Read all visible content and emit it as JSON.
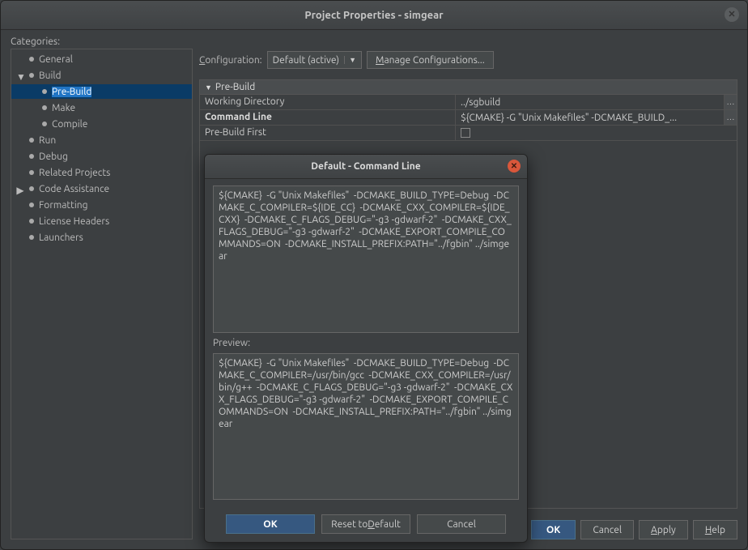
{
  "window": {
    "title": "Project Properties - simgear"
  },
  "categories_label": "Categories:",
  "tree": {
    "general": "General",
    "build": "Build",
    "prebuild": "Pre-Build",
    "make": "Make",
    "compile": "Compile",
    "run": "Run",
    "debug": "Debug",
    "related": "Related Projects",
    "codeassist": "Code Assistance",
    "formatting": "Formatting",
    "license": "License Headers",
    "launchers": "Launchers"
  },
  "config": {
    "label_pre": "C",
    "label_post": "onfiguration:",
    "value": "Default (active)",
    "manage_pre": "M",
    "manage_post": "anage Configurations..."
  },
  "props": {
    "section": "Pre-Build",
    "working_dir_key": "Working Directory",
    "working_dir_val": "../sgbuild",
    "cmdline_key": "Command Line",
    "cmdline_val": "${CMAKE}  -G \"Unix Makefiles\"  -DCMAKE_BUILD_...",
    "first_key": "Pre-Build First"
  },
  "footer": {
    "ok": "OK",
    "cancel": "Cancel",
    "apply_pre": "A",
    "apply_post": "pply",
    "help_pre": "H",
    "help_post": "elp"
  },
  "modal": {
    "title": "Default - Command Line",
    "text": "${CMAKE}  -G \"Unix Makefiles\"  -DCMAKE_BUILD_TYPE=Debug  -DCMAKE_C_COMPILER=${IDE_CC}  -DCMAKE_CXX_COMPILER=${IDE_CXX}  -DCMAKE_C_FLAGS_DEBUG=\"-g3 -gdwarf-2\"  -DCMAKE_CXX_FLAGS_DEBUG=\"-g3 -gdwarf-2\"  -DCMAKE_EXPORT_COMPILE_COMMANDS=ON  -DCMAKE_INSTALL_PREFIX:PATH=\"../fgbin\" ../simgear",
    "preview_label": "Preview:",
    "preview": "${CMAKE}  -G \"Unix Makefiles\"  -DCMAKE_BUILD_TYPE=Debug  -DCMAKE_C_COMPILER=/usr/bin/gcc  -DCMAKE_CXX_COMPILER=/usr/bin/g++  -DCMAKE_C_FLAGS_DEBUG=\"-g3 -gdwarf-2\"  -DCMAKE_CXX_FLAGS_DEBUG=\"-g3 -gdwarf-2\"  -DCMAKE_EXPORT_COMPILE_COMMANDS=ON  -DCMAKE_INSTALL_PREFIX:PATH=\"../fgbin\" ../simgear",
    "ok": "OK",
    "reset_pre": "Reset to ",
    "reset_u": "D",
    "reset_post": "efault",
    "cancel": "Cancel"
  }
}
